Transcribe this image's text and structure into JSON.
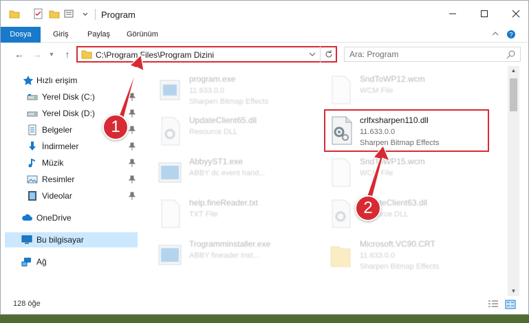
{
  "window": {
    "title": "Program",
    "controls": {
      "minimize_icon": "minimize-icon",
      "maximize_icon": "maximize-icon",
      "close_icon": "close-icon"
    }
  },
  "ribbon": {
    "tabs": [
      {
        "label": "Dosya",
        "active": true
      },
      {
        "label": "Giriş"
      },
      {
        "label": "Paylaş"
      },
      {
        "label": "Görünüm"
      }
    ]
  },
  "nav": {
    "address": "C:\\Program Files\\Program Dizini",
    "search_placeholder": "Ara: Program"
  },
  "sidebar": {
    "quick_access": "Hızlı erişim",
    "items": [
      {
        "label": "Yerel Disk (C:)",
        "icon": "drive-icon",
        "pinned": true
      },
      {
        "label": "Yerel Disk (D:)",
        "icon": "drive-icon",
        "pinned": true
      },
      {
        "label": "Belgeler",
        "icon": "documents-icon",
        "pinned": true
      },
      {
        "label": "İndirmeler",
        "icon": "downloads-icon",
        "pinned": true
      },
      {
        "label": "Müzik",
        "icon": "music-icon",
        "pinned": true
      },
      {
        "label": "Resimler",
        "icon": "pictures-icon",
        "pinned": true
      },
      {
        "label": "Videolar",
        "icon": "videos-icon",
        "pinned": true
      }
    ],
    "onedrive": "OneDrive",
    "this_pc": "Bu bilgisayar",
    "network": "Ağ"
  },
  "files": [
    {
      "name": "program.exe",
      "version": "11.633.0.0",
      "description": "Sharpen Bitmap Effects",
      "faded": true
    },
    {
      "name": "SndToWP12.wcm",
      "version": "WCM File",
      "description": "",
      "faded": true
    },
    {
      "name": "UpdateClient65.dll",
      "version": "Resource DLL",
      "description": "",
      "faded": true
    },
    {
      "name": "crlfxsharpen110.dll",
      "version": "11.633.0.0",
      "description": "Sharpen Bitmap Effects",
      "faded": false,
      "highlighted": true
    },
    {
      "name": "AbbyyST1.exe",
      "version": "ABBY dc event hand...",
      "description": "",
      "faded": true
    },
    {
      "name": "SndToWP15.wcm",
      "version": "WCM File",
      "description": "",
      "faded": true
    },
    {
      "name": "help.fineReader.txt",
      "version": "TXT File",
      "description": "",
      "faded": true
    },
    {
      "name": "UpdateClient63.dll",
      "version": "Resource DLL",
      "description": "",
      "faded": true
    },
    {
      "name": "Trogramminstaller.exe",
      "version": "ABBY fineader Inst...",
      "description": "",
      "faded": true
    },
    {
      "name": "Microsoft.VC90.CRT",
      "version": "11.633.0.0",
      "description": "Sharpen Bitmap Effects",
      "faded": true
    }
  ],
  "status": {
    "item_count": "128 öğe"
  },
  "annotations": [
    {
      "number": "1",
      "color": "#d62b33"
    },
    {
      "number": "2",
      "color": "#d62b33"
    }
  ],
  "colors": {
    "accent": "#1979ca",
    "highlight": "#d62b33",
    "selected_bg": "#cce8ff"
  }
}
